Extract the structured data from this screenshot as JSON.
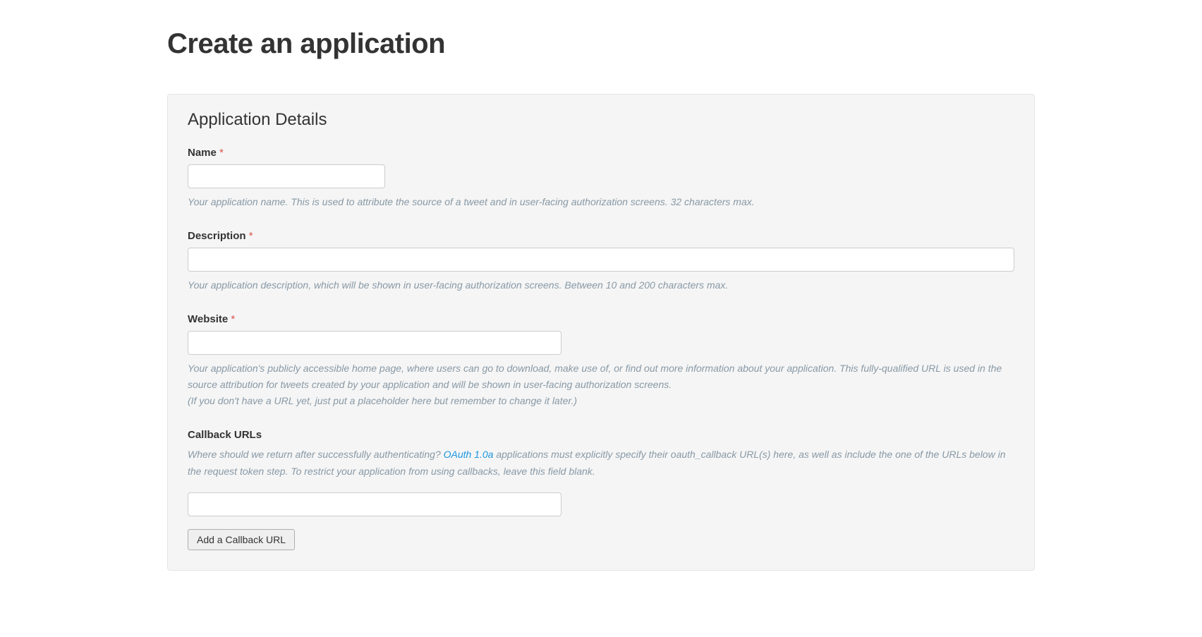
{
  "page": {
    "title": "Create an application"
  },
  "panel": {
    "heading": "Application Details"
  },
  "fields": {
    "name": {
      "label": "Name",
      "required_marker": "*",
      "value": "",
      "help": "Your application name. This is used to attribute the source of a tweet and in user-facing authorization screens. 32 characters max."
    },
    "description": {
      "label": "Description",
      "required_marker": "*",
      "value": "",
      "help": "Your application description, which will be shown in user-facing authorization screens. Between 10 and 200 characters max."
    },
    "website": {
      "label": "Website",
      "required_marker": "*",
      "value": "",
      "help_line1": "Your application's publicly accessible home page, where users can go to download, make use of, or find out more information about your application. This fully-qualified URL is used in the source attribution for tweets created by your application and will be shown in user-facing authorization screens.",
      "help_line2": "(If you don't have a URL yet, just put a placeholder here but remember to change it later.)"
    },
    "callback": {
      "label": "Callback URLs",
      "help_pre": "Where should we return after successfully authenticating? ",
      "help_link_text": "OAuth 1.0a",
      "help_post": " applications must explicitly specify their oauth_callback URL(s) here, as well as include the one of the URLs below in the request token step. To restrict your application from using callbacks, leave this field blank.",
      "value": "",
      "add_button_label": "Add a Callback URL"
    }
  }
}
